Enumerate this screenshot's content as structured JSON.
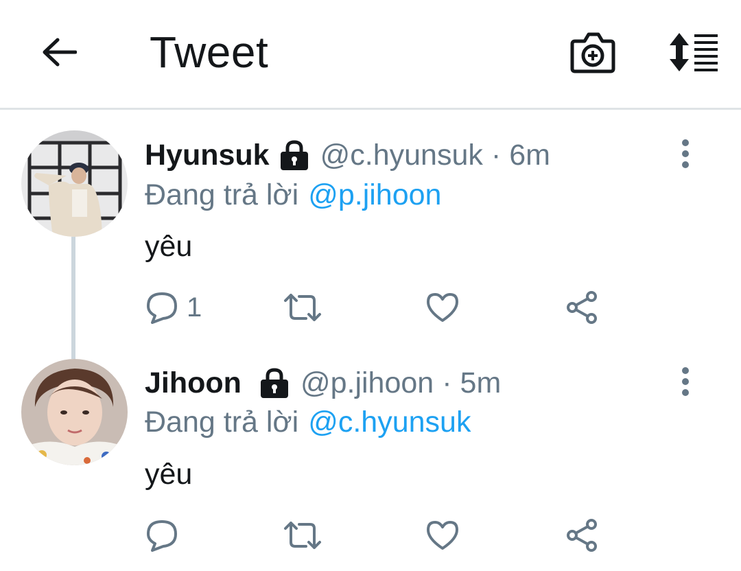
{
  "header": {
    "title": "Tweet",
    "back_icon": "arrow-left-icon",
    "camera_icon": "camera-plus-icon",
    "sort_icon": "sort-list-icon"
  },
  "tweets": [
    {
      "display_name": "Hyunsuk",
      "handle": "@c.hyunsuk",
      "separator": "·",
      "time": "6m",
      "reply_prefix": "Đang trả lời",
      "reply_to": "@p.jihoon",
      "text": "yêu",
      "reply_count": "1",
      "protected": true
    },
    {
      "display_name": "Jihoon",
      "handle": "@p.jihoon",
      "separator": "·",
      "time": "5m",
      "reply_prefix": "Đang trả lời",
      "reply_to": "@c.hyunsuk",
      "text": "yêu",
      "reply_count": "",
      "protected": true
    }
  ],
  "colors": {
    "link": "#1da1f2",
    "secondary_text": "#657786",
    "primary_text": "#14171a",
    "divider": "#dfe3e6"
  }
}
